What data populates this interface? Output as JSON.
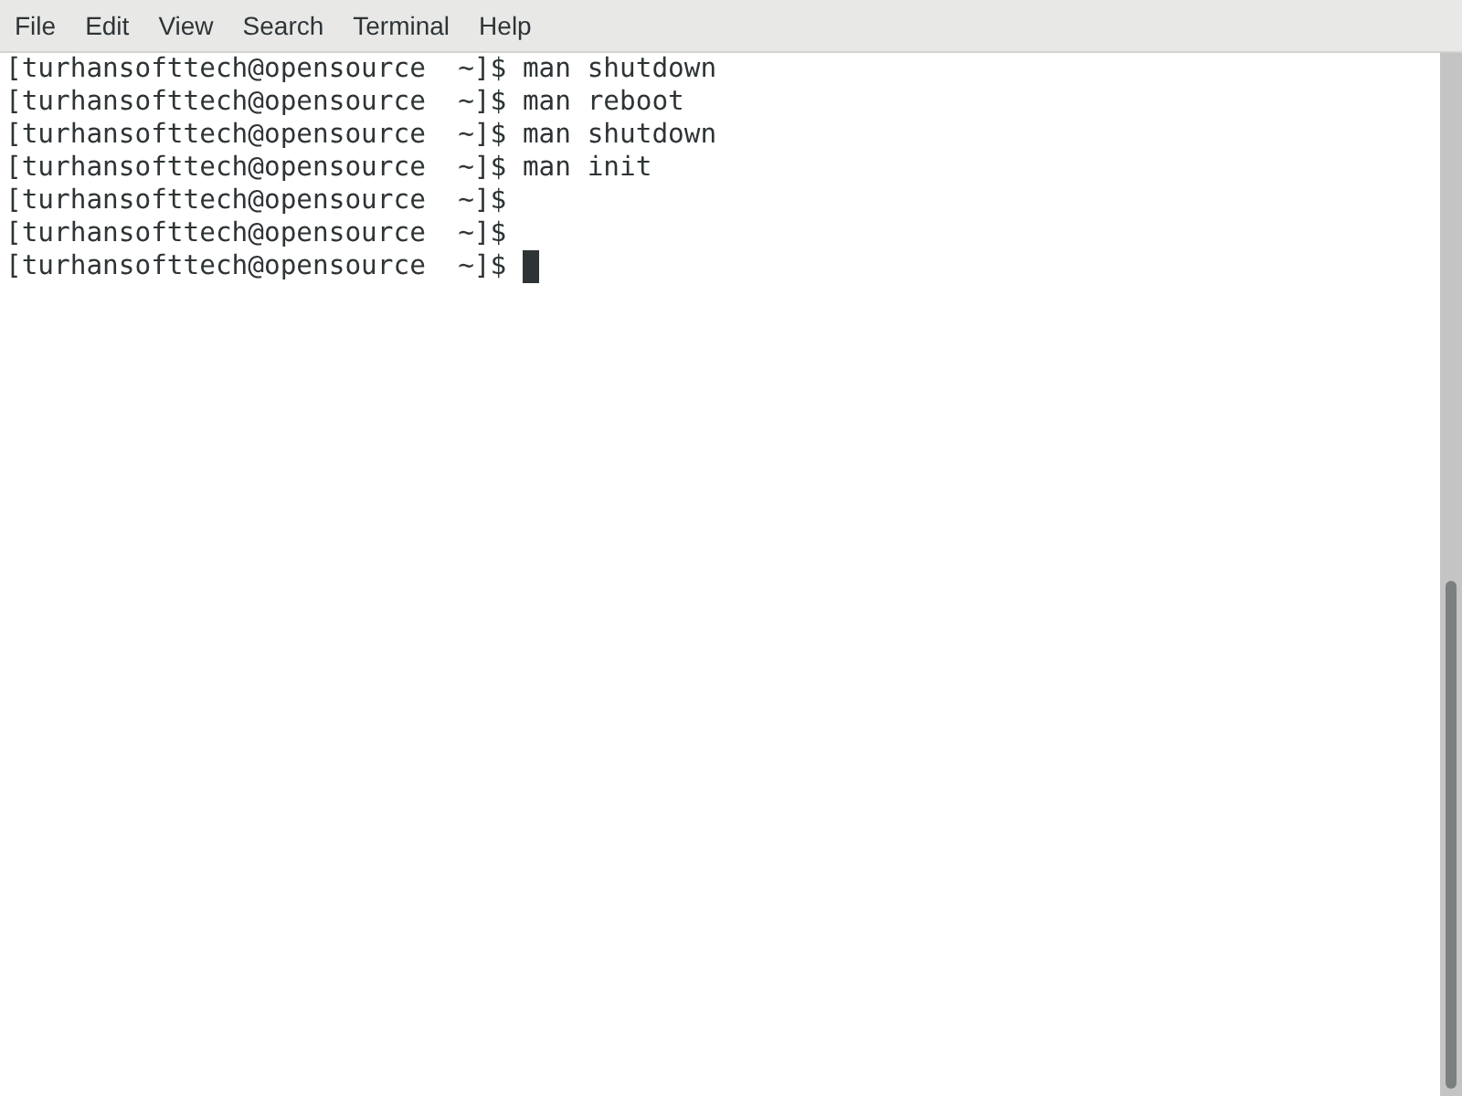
{
  "menu_bar": {
    "items": [
      "File",
      "Edit",
      "View",
      "Search",
      "Terminal",
      "Help"
    ]
  },
  "terminal": {
    "lines": [
      {
        "text": "[turhansofttech@opensource  ~]$ man shutdown",
        "cursor": false
      },
      {
        "text": "[turhansofttech@opensource  ~]$ man reboot",
        "cursor": false
      },
      {
        "text": "[turhansofttech@opensource  ~]$ man shutdown",
        "cursor": false
      },
      {
        "text": "[turhansofttech@opensource  ~]$ man init",
        "cursor": false
      },
      {
        "text": "[turhansofttech@opensource  ~]$",
        "cursor": false
      },
      {
        "text": "[turhansofttech@opensource  ~]$",
        "cursor": false
      },
      {
        "text": "[turhansofttech@opensource  ~]$",
        "cursor": true
      }
    ]
  }
}
